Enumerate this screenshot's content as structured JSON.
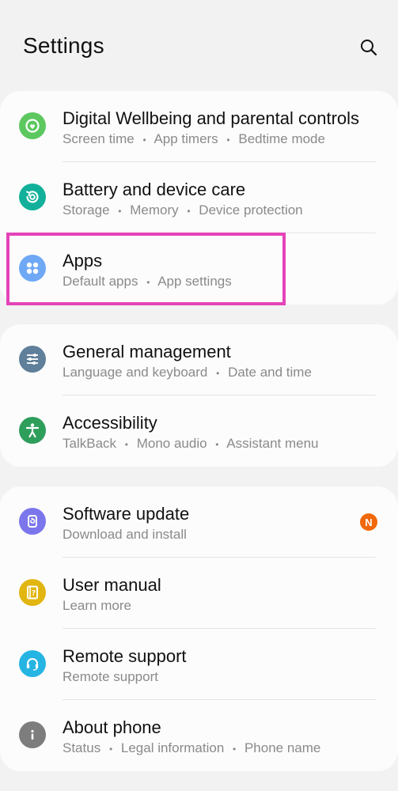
{
  "header": {
    "title": "Settings",
    "search_icon": "search-icon"
  },
  "colors": {
    "highlight": "#e543b9",
    "badge": "#f0680a",
    "wellbeing": "#5cc85f",
    "battery": "#12b09a",
    "apps": "#6fa8f5",
    "general": "#5f7f9a",
    "accessibility": "#2e9e5b",
    "software": "#7b76ec",
    "manual": "#e2b611",
    "remote": "#26b5e2",
    "about": "#7d7d7d"
  },
  "groups": [
    {
      "items": [
        {
          "label": "Digital Wellbeing and parental controls",
          "sub": [
            "Screen time",
            "App timers",
            "Bedtime mode"
          ],
          "icon": "wellbeing-icon"
        },
        {
          "label": "Battery and device care",
          "sub": [
            "Storage",
            "Memory",
            "Device protection"
          ],
          "icon": "device-care-icon"
        },
        {
          "label": "Apps",
          "sub": [
            "Default apps",
            "App settings"
          ],
          "icon": "apps-icon"
        }
      ]
    },
    {
      "items": [
        {
          "label": "General management",
          "sub": [
            "Language and keyboard",
            "Date and time"
          ],
          "icon": "sliders-icon"
        },
        {
          "label": "Accessibility",
          "sub": [
            "TalkBack",
            "Mono audio",
            "Assistant menu"
          ],
          "icon": "accessibility-icon"
        }
      ]
    },
    {
      "items": [
        {
          "label": "Software update",
          "sub": [
            "Download and install"
          ],
          "icon": "software-update-icon",
          "badge": "N"
        },
        {
          "label": "User manual",
          "sub": [
            "Learn more"
          ],
          "icon": "manual-icon"
        },
        {
          "label": "Remote support",
          "sub": [
            "Remote support"
          ],
          "icon": "headset-icon"
        },
        {
          "label": "About phone",
          "sub": [
            "Status",
            "Legal information",
            "Phone name"
          ],
          "icon": "info-icon"
        }
      ]
    }
  ],
  "separator": "•"
}
